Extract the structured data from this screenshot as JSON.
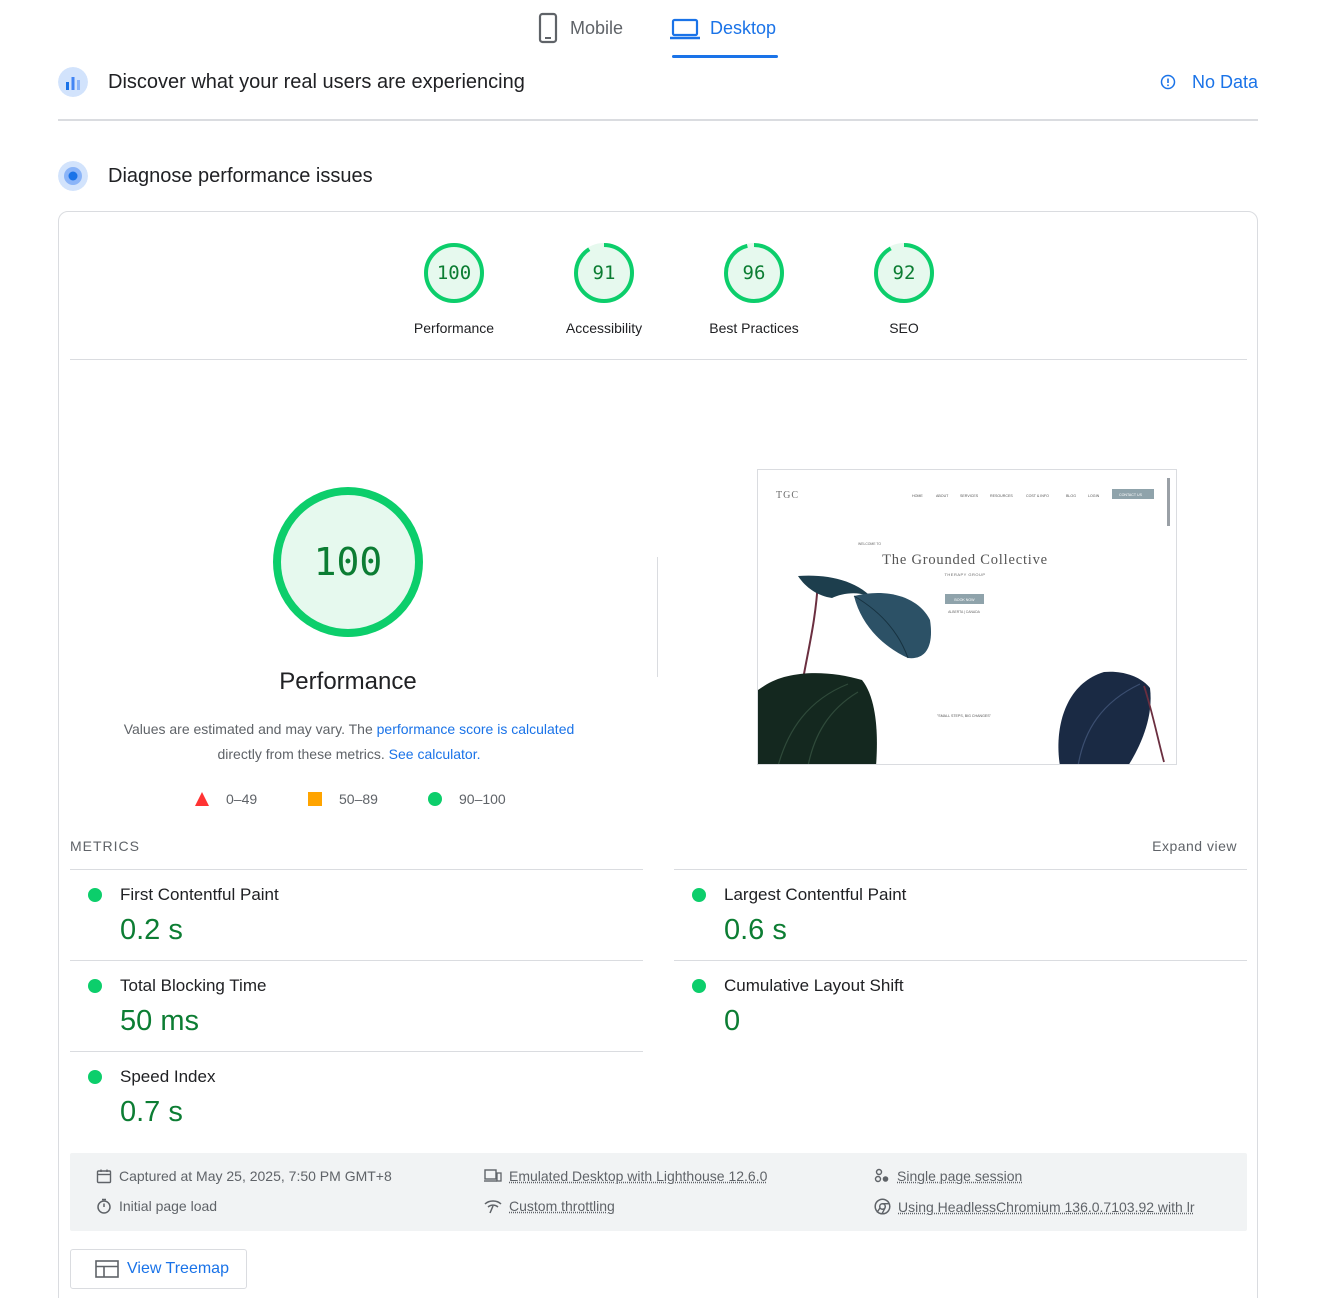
{
  "tabs": {
    "mobile": "Mobile",
    "desktop": "Desktop"
  },
  "field_data": {
    "title": "Discover what your real users are experiencing",
    "status": "No Data"
  },
  "diagnose": {
    "title": "Diagnose performance issues"
  },
  "scores": [
    {
      "label": "Performance",
      "value": "100",
      "fraction": 1.0
    },
    {
      "label": "Accessibility",
      "value": "91",
      "fraction": 0.91
    },
    {
      "label": "Best Practices",
      "value": "96",
      "fraction": 0.96
    },
    {
      "label": "SEO",
      "value": "92",
      "fraction": 0.92
    }
  ],
  "performance": {
    "score": "100",
    "title": "Performance",
    "desc_prefix": "Values are estimated and may vary. The ",
    "desc_link": "performance score is calculated",
    "desc_mid": "directly from these metrics.",
    "desc_calc": "See calculator."
  },
  "legend": {
    "fail": "0–49",
    "average": "50–89",
    "pass": "90–100"
  },
  "screenshot": {
    "logo": "TGC",
    "nav": [
      "HOME",
      "ABOUT",
      "SERVICES",
      "RESOURCES",
      "COST & INFO",
      "BLOG",
      "LOGIN"
    ],
    "nav_button": "CONTACT US",
    "welcome": "WELCOME TO",
    "site_title": "The Grounded Collective",
    "subtitle": "THERAPY GROUP",
    "cta": "BOOK NOW",
    "location": "ALBERTA | CANADA",
    "tagline": "\"SMALL STEPS, BIG CHANGES\""
  },
  "metrics": {
    "header": "METRICS",
    "expand": "Expand view",
    "items": [
      {
        "name": "First Contentful Paint",
        "value": "0.2 s"
      },
      {
        "name": "Largest Contentful Paint",
        "value": "0.6 s"
      },
      {
        "name": "Total Blocking Time",
        "value": "50 ms"
      },
      {
        "name": "Cumulative Layout Shift",
        "value": "0"
      },
      {
        "name": "Speed Index",
        "value": "0.7 s"
      }
    ]
  },
  "run_info": {
    "captured": "Captured at May 25, 2025, 7:50 PM GMT+8",
    "load": "Initial page load",
    "device": "Emulated Desktop with Lighthouse 12.6.0",
    "throttling": "Custom throttling",
    "session": "Single page session",
    "browser": "Using HeadlessChromium 136.0.7103.92 with lr"
  },
  "treemap_label": "View Treemap",
  "colors": {
    "pass": "#0cce6b",
    "pass_text": "#0c7d33",
    "link": "#1a73e8",
    "fail": "#ff3333",
    "average": "#ffa400"
  }
}
